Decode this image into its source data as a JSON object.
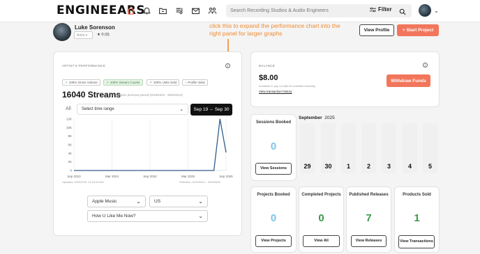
{
  "header": {
    "logo": "ENGINEEARS",
    "search_placeholder": "Search Recording Studios & Audio Engineers",
    "filter_label": "Filter",
    "nav_icons": [
      "home-icon",
      "bell-icon",
      "folder-icon",
      "music-list-icon",
      "mail-icon",
      "community-icon"
    ],
    "accent_color": "#f1765b"
  },
  "profile": {
    "name": "Luke Sorenson",
    "role_select": "Artist",
    "rating": "★ 0 (0)",
    "view_profile_label": "View Profile",
    "start_project_label": "+ Start Project"
  },
  "annotation": {
    "text": "click this to expand the performance chart into the right panel for larger graphs",
    "color": "#f08a2c"
  },
  "performance": {
    "title": "ARTIST'S PERFORMANCE",
    "chips": [
      {
        "label": "100%  Gross Volume",
        "active": false
      },
      {
        "label": "100%  Stream Counts",
        "active": true
      },
      {
        "label": "100%  Units Sold",
        "active": false
      },
      {
        "label": "-- Profile Visits",
        "active": false
      }
    ],
    "stat_value": "16040 Streams",
    "stat_sub": "0 Streams previous period (9/19/2022 - 9/30/2024)",
    "range_all": "All",
    "range_select": "Select time range",
    "date_start": "Sep 19",
    "date_sep": "–",
    "date_end": "Sep 30",
    "updated": "Updated: 9/30/2025, 11:15:20 AM",
    "selection": "Selection: 9/19/2023 – 9/30/2025"
  },
  "chart_data": {
    "type": "line",
    "x_ticks": [
      "Sep 2023",
      "Mar 2024",
      "Sep 2024",
      "Mar 2025",
      "Sep 2025"
    ],
    "y_ticks": [
      "12K",
      "10K",
      "8K",
      "6K",
      "4K",
      "2K",
      "0"
    ],
    "ylim": [
      0,
      12000
    ],
    "series": [
      {
        "points": [
          [
            0,
            0
          ],
          [
            0.3,
            0
          ],
          [
            0.6,
            0
          ],
          [
            0.9,
            0
          ],
          [
            0.92,
            0
          ],
          [
            0.96,
            12000
          ],
          [
            1,
            4200
          ]
        ]
      }
    ]
  },
  "dropdowns": {
    "platform": "Apple Music",
    "country": "US",
    "song": "How U Like Me Now?"
  },
  "balance": {
    "title": "BALANCE",
    "amount": "$8.00",
    "sub": "Available to pay out ($8.00 available instantly)",
    "link": "View transaction history",
    "withdraw_label": "Withdraw Funds"
  },
  "stats": {
    "sessions": {
      "title": "Sessions Booked",
      "value": "0",
      "button": "View Sessions",
      "color": "#7cc4e8"
    },
    "projects_booked": {
      "title": "Projects Booked",
      "value": "0",
      "button": "View Projects",
      "color": "#7cc4e8"
    },
    "completed_projects": {
      "title": "Completed Projects",
      "value": "0",
      "button": "View All",
      "color": "#3a9a4a"
    },
    "published_releases": {
      "title": "Published Releases",
      "value": "7",
      "button": "View Releases",
      "color": "#3a9a4a"
    },
    "products_sold": {
      "title": "Products Sold",
      "value": "1",
      "button": "View Transactions",
      "color": "#3a9a4a"
    }
  },
  "calendar": {
    "month": "September",
    "year": "2025",
    "days": [
      "29",
      "30",
      "1",
      "2",
      "3",
      "4",
      "5"
    ]
  }
}
